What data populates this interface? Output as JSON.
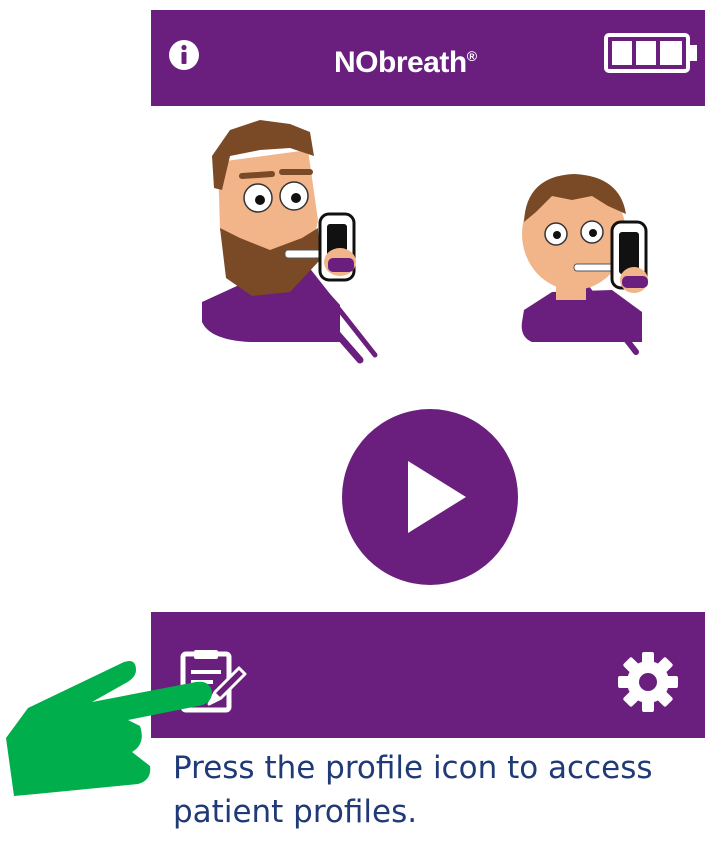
{
  "app": {
    "brand_name": "NObreath",
    "brand_mark": "®"
  },
  "header": {
    "info_icon": "info-icon",
    "battery_icon": "battery-full-icon"
  },
  "main": {
    "illustrations": [
      "adult-patient-illustration",
      "child-patient-illustration"
    ],
    "play_icon": "play-icon"
  },
  "footer": {
    "profile_icon": "profile-edit-icon",
    "settings_icon": "gear-icon"
  },
  "instruction": {
    "text": "Press the profile icon to access patient profiles."
  },
  "colors": {
    "brand_purple": "#6a1f7e",
    "pointer_green": "#00ae4c",
    "caption_blue": "#1f3a77"
  }
}
